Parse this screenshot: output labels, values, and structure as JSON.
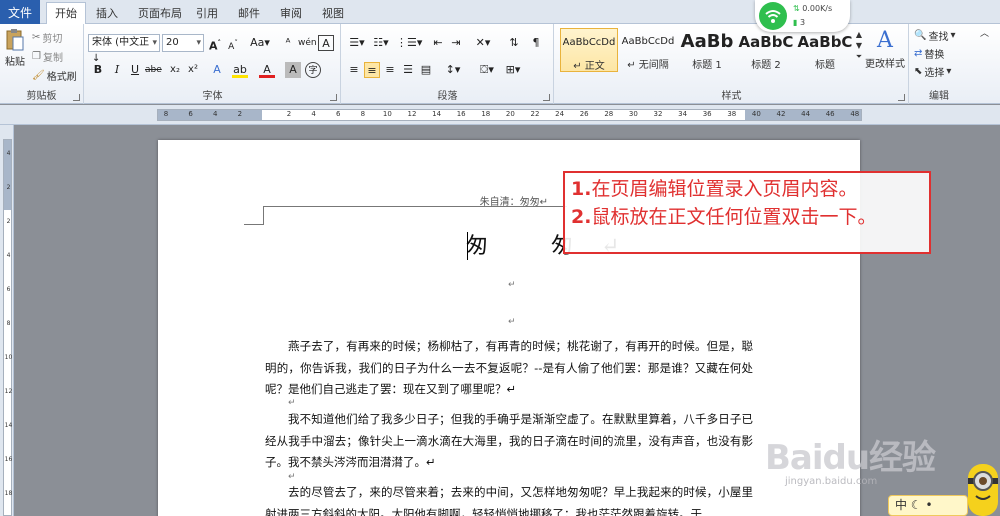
{
  "tabs": {
    "file": "文件",
    "items": [
      "开始",
      "插入",
      "页面布局",
      "引用",
      "邮件",
      "审阅",
      "视图"
    ],
    "active": "开始"
  },
  "clipboard": {
    "paste": "粘贴",
    "cut": "剪切",
    "copy": "复制",
    "format_painter": "格式刷",
    "label": "剪贴板"
  },
  "font": {
    "name": "宋体 (中文正↓",
    "size": "20",
    "label": "字体"
  },
  "paragraph": {
    "label": "段落"
  },
  "styles": {
    "items": [
      {
        "sample": "AaBbCcDd",
        "name": "↵ 正文",
        "selected": true
      },
      {
        "sample": "AaBbCcDd",
        "name": "↵ 无间隔",
        "selected": false
      },
      {
        "sample": "AaBb",
        "name": "标题 1",
        "selected": false
      },
      {
        "sample": "AaBbC",
        "name": "标题 2",
        "selected": false
      },
      {
        "sample": "AaBbC",
        "name": "标题",
        "selected": false
      }
    ],
    "change": "更改样式",
    "label": "样式"
  },
  "editing": {
    "find": "查找",
    "replace": "替换",
    "select": "选择",
    "label": "编辑"
  },
  "wifi": {
    "speed": "0.00K/s",
    "count": "3"
  },
  "ruler": {
    "marks": [
      "8",
      "6",
      "4",
      "2",
      "",
      "2",
      "4",
      "6",
      "8",
      "10",
      "12",
      "14",
      "16",
      "18",
      "20",
      "22",
      "24",
      "26",
      "28",
      "30",
      "32",
      "34",
      "36",
      "38",
      "40",
      "42",
      "44",
      "46",
      "48"
    ],
    "vmarks": [
      "4",
      "2",
      "2",
      "4",
      "6",
      "8",
      "10",
      "12",
      "14",
      "16",
      "18"
    ]
  },
  "document": {
    "header": "朱自清：匆匆↵",
    "title": "匆  匆↵",
    "paragraphs": [
      "燕子去了，有再来的时候；杨柳枯了，有再青的时候；桃花谢了，有再开的时候。但是，聪明的，你告诉我，我们的日子为什么一去不复返呢？--是有人偷了他们罢：那是谁？又藏在何处呢？是他们自己逃走了罢：现在又到了哪里呢？↵",
      "我不知道他们给了我多少日子；但我的手确乎是渐渐空虚了。在默默里算着，八千多日子已经从我手中溜去；像针尖上一滴水滴在大海里，我的日子滴在时间的流里，没有声音，也没有影子。我不禁头涔涔而泪潸潸了。↵",
      "去的尽管去了，来的尽管来着；去来的中间，又怎样地匆匆呢？早上我起来的时候，小屋里射进两三方斜斜的太阳。太阳他有脚啊，轻轻悄悄地挪移了；我也茫茫然跟着旋转。于"
    ]
  },
  "annotation": {
    "line1_num": "1.",
    "line1": "在页眉编辑位置录入页眉内容。",
    "line2_num": "2.",
    "line2": "鼠标放在正文任何位置双击一下。"
  },
  "watermark": {
    "brand": "Baidu经验",
    "url": "jingyan.baidu.com"
  },
  "ime": "中"
}
